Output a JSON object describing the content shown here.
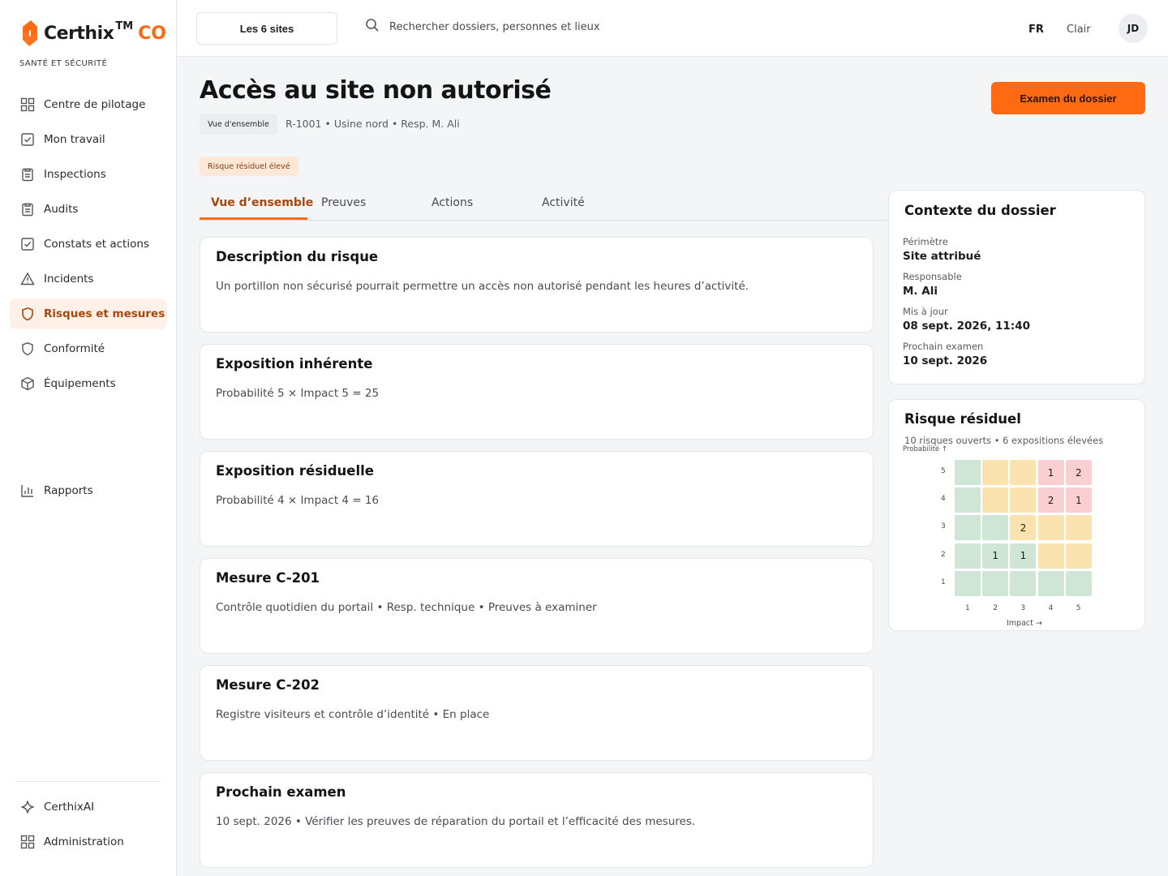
{
  "brand": {
    "name": "Certhix",
    "tm": "TM",
    "suffix": "CO",
    "subtitle": "SANTÉ ET SÉCURITÉ",
    "accent": "#ff6a13"
  },
  "sidebar": {
    "items": [
      {
        "label": "Centre de pilotage",
        "icon": "grid-icon"
      },
      {
        "label": "Mon travail",
        "icon": "checkbox-icon"
      },
      {
        "label": "Inspections",
        "icon": "clipboard-icon"
      },
      {
        "label": "Audits",
        "icon": "clipboard-icon"
      },
      {
        "label": "Constats et actions",
        "icon": "checkbox-icon"
      },
      {
        "label": "Incidents",
        "icon": "warning-icon"
      },
      {
        "label": "Risques et mesures",
        "icon": "shield-icon",
        "active": true
      },
      {
        "label": "Conformité",
        "icon": "shield-icon"
      },
      {
        "label": "Équipements",
        "icon": "cube-icon"
      }
    ],
    "reports": {
      "label": "Rapports",
      "icon": "bar-chart-icon"
    },
    "bottom": [
      {
        "label": "CerthixAI",
        "icon": "sparkle-icon"
      },
      {
        "label": "Administration",
        "icon": "grid-icon"
      }
    ]
  },
  "topbar": {
    "site_selector": "Les 6 sites",
    "search_placeholder": "Rechercher dossiers, personnes et lieux",
    "lang": "FR",
    "theme": "Clair",
    "avatar": "JD"
  },
  "header": {
    "title": "Accès au site non autorisé",
    "chip": "Vue d'ensemble",
    "meta": "R-1001 • Usine nord • Resp. M. Ali",
    "review_button": "Examen du dossier",
    "risk_badge": "Risque résiduel élevé"
  },
  "tabs": [
    "Vue d’ensemble",
    "Preuves",
    "Actions",
    "Activité"
  ],
  "cards": [
    {
      "title": "Description du risque",
      "text": "Un portillon non sécurisé pourrait permettre un accès non autorisé pendant les heures d’activité."
    },
    {
      "title": "Exposition inhérente",
      "text": "Probabilité 5 × Impact 5 = 25"
    },
    {
      "title": "Exposition résiduelle",
      "text": "Probabilité 4 × Impact 4 = 16"
    },
    {
      "title": "Mesure C-201",
      "text": "Contrôle quotidien du portail • Resp. technique • Preuves à examiner"
    },
    {
      "title": "Mesure C-202",
      "text": "Registre visiteurs et contrôle d’identité • En place"
    },
    {
      "title": "Prochain examen",
      "text": "10 sept. 2026 • Vérifier les preuves de réparation du portail et l’efficacité des mesures."
    }
  ],
  "context": {
    "title": "Contexte du dossier",
    "fields": [
      {
        "label": "Périmètre",
        "value": "Site attribué"
      },
      {
        "label": "Responsable",
        "value": "M. Ali"
      },
      {
        "label": "Mis à jour",
        "value": "08 sept. 2026, 11:40"
      },
      {
        "label": "Prochain examen",
        "value": "10 sept. 2026"
      }
    ]
  },
  "residual": {
    "title": "Risque résiduel",
    "subtitle": "10 risques ouverts • 6 expositions élevées",
    "y_label": "Probabilité ↑",
    "x_label": "Impact →",
    "colors": {
      "low": "#cfe6d6",
      "medium": "#fbe3b0",
      "high": "#f9cfd1"
    }
  },
  "chart_data": {
    "type": "heatmap",
    "title": "Risque résiduel",
    "xlabel": "Impact",
    "ylabel": "Probabilité",
    "x": [
      1,
      2,
      3,
      4,
      5
    ],
    "y": [
      5,
      4,
      3,
      2,
      1
    ],
    "counts": [
      [
        null,
        null,
        null,
        1,
        2
      ],
      [
        null,
        null,
        null,
        2,
        1
      ],
      [
        null,
        null,
        2,
        null,
        null
      ],
      [
        null,
        1,
        1,
        null,
        null
      ],
      [
        null,
        null,
        null,
        null,
        null
      ]
    ],
    "levels": [
      [
        "low",
        "medium",
        "medium",
        "high",
        "high"
      ],
      [
        "low",
        "medium",
        "medium",
        "high",
        "high"
      ],
      [
        "low",
        "low",
        "medium",
        "medium",
        "medium"
      ],
      [
        "low",
        "low",
        "low",
        "medium",
        "medium"
      ],
      [
        "low",
        "low",
        "low",
        "low",
        "low"
      ]
    ]
  }
}
